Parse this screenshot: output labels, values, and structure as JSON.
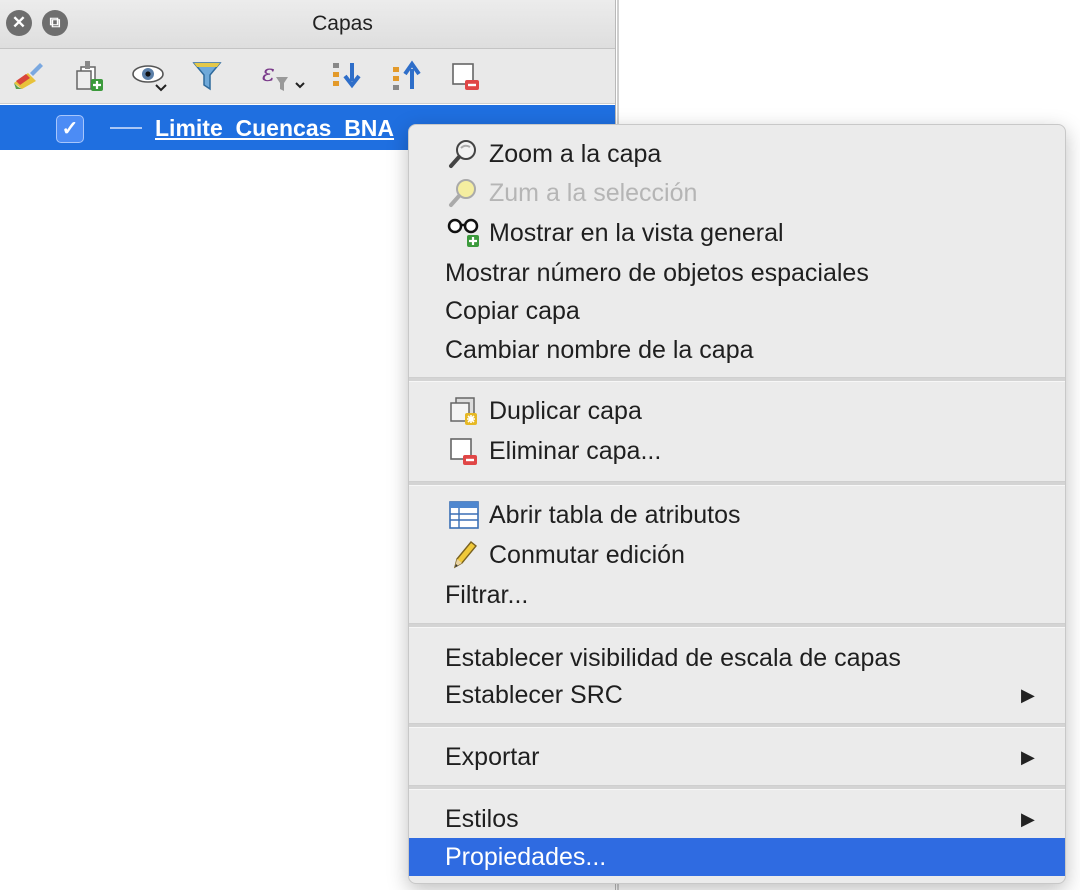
{
  "panel": {
    "title": "Capas",
    "close_glyph": "✕",
    "float_glyph": "⧉",
    "toolbar_icons": [
      "style-manager-icon",
      "add-group-icon",
      "visibility-icon",
      "filter-legend-icon",
      "expression-filter-icon",
      "expand-all-icon",
      "collapse-all-icon",
      "remove-layer-icon"
    ],
    "layer": {
      "checked_glyph": "✓",
      "name": "Limite_Cuencas_BNA"
    }
  },
  "menu": {
    "items": [
      {
        "label": "Zoom a la capa",
        "icon": "zoom-to-layer-icon",
        "enabled": true
      },
      {
        "label": "Zum a la selección",
        "icon": "zoom-to-selection-icon",
        "enabled": false
      },
      {
        "label": "Mostrar en la vista general",
        "icon": "overview-icon",
        "enabled": true
      },
      {
        "label": "Mostrar número de objetos espaciales",
        "enabled": true
      },
      {
        "label": "Copiar capa",
        "enabled": true
      },
      {
        "label": "Cambiar nombre de la capa",
        "enabled": true
      },
      {
        "label": "Duplicar capa",
        "icon": "duplicate-layer-icon",
        "enabled": true
      },
      {
        "label": "Eliminar capa...",
        "icon": "remove-layer-icon",
        "enabled": true
      },
      {
        "label": "Abrir tabla de atributos",
        "icon": "attribute-table-icon",
        "enabled": true
      },
      {
        "label": "Conmutar edición",
        "icon": "pencil-icon",
        "enabled": true
      },
      {
        "label": "Filtrar...",
        "enabled": true
      },
      {
        "label": "Establecer visibilidad de escala de capas",
        "enabled": true
      },
      {
        "label": "Establecer SRC",
        "enabled": true,
        "submenu": true
      },
      {
        "label": "Exportar",
        "enabled": true,
        "submenu": true
      },
      {
        "label": "Estilos",
        "enabled": true,
        "submenu": true
      },
      {
        "label": "Propiedades...",
        "enabled": true,
        "selected": true
      }
    ],
    "submenu_glyph": "▶"
  },
  "colors": {
    "selection": "#1f6fe0",
    "menu_highlight": "#2f6be1",
    "menu_bg": "#ebebeb",
    "disabled_text": "#b5b5b5"
  }
}
